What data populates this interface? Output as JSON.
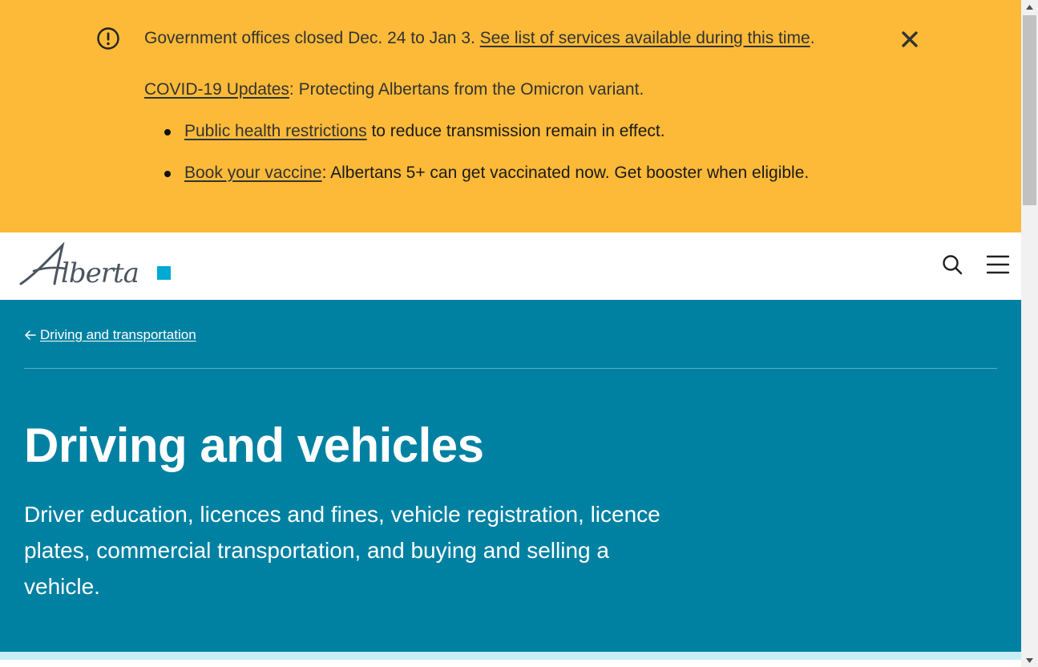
{
  "alert": {
    "line1_text": "Government offices closed Dec. 24 to Jan 3. ",
    "line1_link": "See list of services available during this time",
    "line1_end": ".",
    "line2_link": "COVID-19 Updates",
    "line2_text": ": Protecting Albertans from the Omicron variant.",
    "items": [
      {
        "link": "Public health restrictions",
        "text": " to reduce transmission remain in effect."
      },
      {
        "link": "Book your vaccine",
        "text": ": Albertans 5+ can get vaccinated now. Get booster when eligible."
      }
    ],
    "icons": {
      "warning": "exclamation-circle-icon",
      "close": "close-icon"
    },
    "colors": {
      "background": "#fdba38"
    }
  },
  "header": {
    "logo_text": "Alberta",
    "icons": {
      "search": "search-icon",
      "menu": "hamburger-menu-icon"
    }
  },
  "hero": {
    "breadcrumb": "Driving and transportation",
    "title": "Driving and vehicles",
    "lead": "Driver education, licences and fines, vehicle registration, licence plates, commercial transportation, and buying and selling a vehicle.",
    "colors": {
      "background": "#0081a2"
    }
  }
}
